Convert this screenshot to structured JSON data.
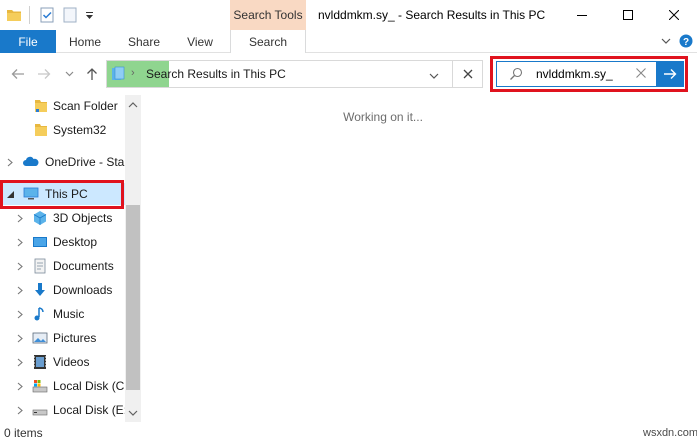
{
  "titlebar": {
    "title": "nvlddmkm.sy_ - Search Results in This PC",
    "context_tab": "Search Tools"
  },
  "ribbon": {
    "tabs": [
      "File",
      "Home",
      "Share",
      "View",
      "Search"
    ]
  },
  "address": {
    "path": "Search Results in This PC"
  },
  "search": {
    "value": "nvlddmkm.sy_"
  },
  "nav": {
    "items": [
      {
        "label": "Scan Folder",
        "icon": "folder-icon"
      },
      {
        "label": "System32",
        "icon": "folder-icon"
      },
      {
        "label": "OneDrive - Star",
        "icon": "onedrive-icon"
      },
      {
        "label": "This PC",
        "icon": "computer-icon"
      },
      {
        "label": "3D Objects",
        "icon": "3d-objects-icon"
      },
      {
        "label": "Desktop",
        "icon": "desktop-icon"
      },
      {
        "label": "Documents",
        "icon": "documents-icon"
      },
      {
        "label": "Downloads",
        "icon": "downloads-icon"
      },
      {
        "label": "Music",
        "icon": "music-icon"
      },
      {
        "label": "Pictures",
        "icon": "pictures-icon"
      },
      {
        "label": "Videos",
        "icon": "videos-icon"
      },
      {
        "label": "Local Disk (C:",
        "icon": "local-disk-icon"
      },
      {
        "label": "Local Disk (E:)",
        "icon": "local-disk-icon"
      }
    ]
  },
  "content": {
    "status": "Working on it..."
  },
  "statusbar": {
    "items_count": "0 items"
  },
  "watermark": "wsxdn.com",
  "colors": {
    "accent": "#1979ca",
    "highlight": "#e0131e",
    "context_tab": "#f9d9c3",
    "selection": "#cce8ff"
  }
}
